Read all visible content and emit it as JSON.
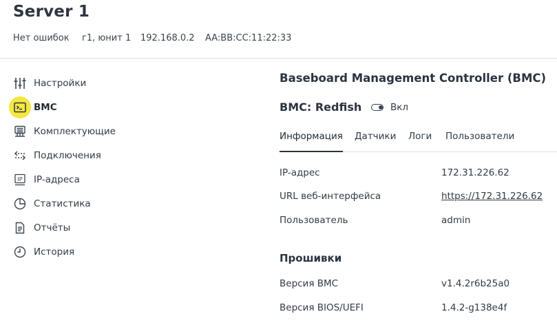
{
  "header": {
    "title": "Server 1",
    "status": "Нет ошибок",
    "location": "г1, юнит 1",
    "ip": "192.168.0.2",
    "mac": "AA:BB:CC:11:22:33"
  },
  "sidebar": {
    "items": [
      {
        "label": "Настройки",
        "icon": "sliders-icon"
      },
      {
        "label": "BMC",
        "icon": "terminal-icon",
        "active": true
      },
      {
        "label": "Комплектующие",
        "icon": "hardware-icon"
      },
      {
        "label": "Подключения",
        "icon": "connections-icon"
      },
      {
        "label": "IP-адреса",
        "icon": "ip-icon"
      },
      {
        "label": "Статистика",
        "icon": "pie-chart-icon"
      },
      {
        "label": "Отчёты",
        "icon": "document-icon"
      },
      {
        "label": "История",
        "icon": "clock-icon"
      }
    ]
  },
  "panel": {
    "title": "Baseboard Management Controller (BMC)",
    "subtitle": "BMC: Redfish",
    "toggle_label": "Вкл",
    "tabs": [
      "Информация",
      "Датчики",
      "Логи",
      "Пользователи"
    ],
    "info": [
      {
        "label": "IP-адрес",
        "value": "172.31.226.62"
      },
      {
        "label": "URL веб-интерфейса",
        "value": "https://172.31.226.62"
      },
      {
        "label": "Пользователь",
        "value": "admin"
      }
    ],
    "firmware_title": "Прошивки",
    "firmware": [
      {
        "label": "Версия BMC",
        "value": "v1.4.2r6b25a0"
      },
      {
        "label": "Версия BIOS/UEFI",
        "value": "1.4.2-g138e4f"
      }
    ]
  }
}
